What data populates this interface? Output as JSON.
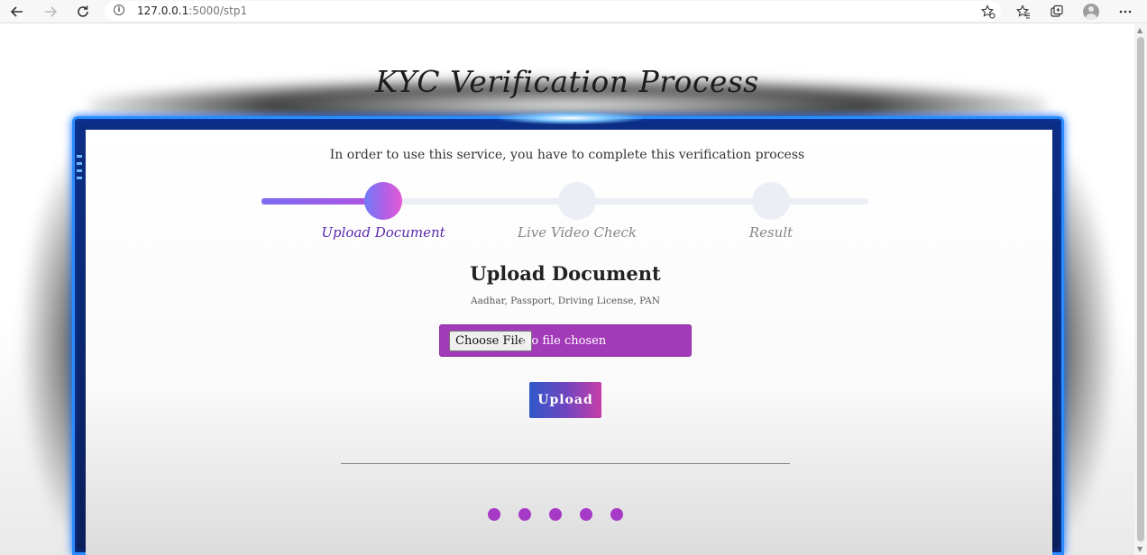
{
  "browser": {
    "url_host": "127.0.0.1",
    "url_rest": ":5000/stp1",
    "icons": [
      "back-icon",
      "forward-icon",
      "reload-icon",
      "info-icon",
      "favorite-add-icon",
      "favorites-icon",
      "collections-icon",
      "profile-icon",
      "more-icon"
    ]
  },
  "page": {
    "title": "KYC Verification Process",
    "intro": "In order to use this service, you have to complete this verification process",
    "progress": {
      "current_step": 1,
      "steps": [
        {
          "label": "Upload Document"
        },
        {
          "label": "Live Video Check"
        },
        {
          "label": "Result"
        }
      ]
    },
    "section": {
      "title": "Upload Document",
      "subtitle": "Aadhar, Passport, Driving License, PAN"
    },
    "file_input": {
      "button_label": "Choose File",
      "status": "No file chosen"
    },
    "upload_button": "Upload",
    "pagination_dots": 5
  },
  "colors": {
    "accent_purple": "#a33ab8",
    "frame_blue": "#2a8cff",
    "active_step_label": "#5a2ab0"
  }
}
